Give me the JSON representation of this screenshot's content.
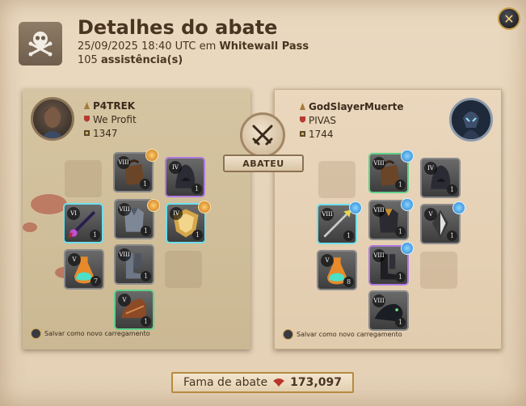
{
  "header": {
    "title": "Detalhes do abate",
    "datetime": "25/09/2025 18:40 UTC",
    "location_prefix": "em",
    "location": "Whitewall Pass",
    "assists_count": "105",
    "assists_label": "assistência(s)"
  },
  "center": {
    "badge_icon": "crossed-swords-icon",
    "ribbon_label": "ABATEU"
  },
  "killer": {
    "name": "P4TREK",
    "guild": "We Profit",
    "item_power": "1347",
    "save_loadout": "Salvar como novo carregamento",
    "equipment": [
      {
        "slot": "bag",
        "tier": "VIII",
        "count": "1",
        "rarity": "gray",
        "icon": "bag-icon"
      },
      {
        "slot": "head",
        "tier": "IV",
        "count": "1",
        "rarity": "purple",
        "icon": "hood-icon"
      },
      {
        "slot": "weapon",
        "tier": "VI",
        "count": "1",
        "rarity": "cyan",
        "icon": "staff-icon"
      },
      {
        "slot": "armor",
        "tier": "VIII",
        "count": "1",
        "rarity": "gray",
        "icon": "plate-armor-icon"
      },
      {
        "slot": "offhand",
        "tier": "IV",
        "count": "1",
        "rarity": "cyan",
        "icon": "shield-icon"
      },
      {
        "slot": "potion",
        "tier": "V",
        "count": "7",
        "rarity": "gray",
        "icon": "potion-icon"
      },
      {
        "slot": "shoes",
        "tier": "VIII",
        "count": "1",
        "rarity": "gray",
        "icon": "boots-icon"
      },
      {
        "slot": "mount",
        "tier": "V",
        "count": "1",
        "rarity": "green",
        "icon": "mount-icon"
      }
    ]
  },
  "victim": {
    "name": "GodSlayerMuerte",
    "guild": "PIVAS",
    "item_power": "1744",
    "save_loadout": "Salvar como novo carregamento",
    "equipment": [
      {
        "slot": "bag",
        "tier": "VIII",
        "count": "1",
        "rarity": "green",
        "icon": "bag-icon"
      },
      {
        "slot": "head",
        "tier": "IV",
        "count": "1",
        "rarity": "gray",
        "icon": "hood-icon"
      },
      {
        "slot": "weapon",
        "tier": "VIII",
        "count": "1",
        "rarity": "cyan",
        "icon": "spear-icon"
      },
      {
        "slot": "armor",
        "tier": "VIII",
        "count": "1",
        "rarity": "gray",
        "icon": "dark-armor-icon"
      },
      {
        "slot": "offhand",
        "tier": "V",
        "count": "1",
        "rarity": "gray",
        "icon": "torch-icon"
      },
      {
        "slot": "potion",
        "tier": "V",
        "count": "8",
        "rarity": "gray",
        "icon": "potion-icon"
      },
      {
        "slot": "shoes",
        "tier": "VIII",
        "count": "1",
        "rarity": "purple",
        "icon": "boots-icon"
      },
      {
        "slot": "mount",
        "tier": "VIII",
        "count": "1",
        "rarity": "gray",
        "icon": "panther-mount-icon"
      }
    ]
  },
  "footer": {
    "label": "Fama de abate",
    "value": "173,097",
    "icon": "fame-icon"
  },
  "colors": {
    "accent_gold": "#c9a04a",
    "rarity_green": "#62d08a",
    "rarity_cyan": "#6de0ef",
    "rarity_purple": "#b07adf",
    "fame_red": "#b8352b"
  }
}
